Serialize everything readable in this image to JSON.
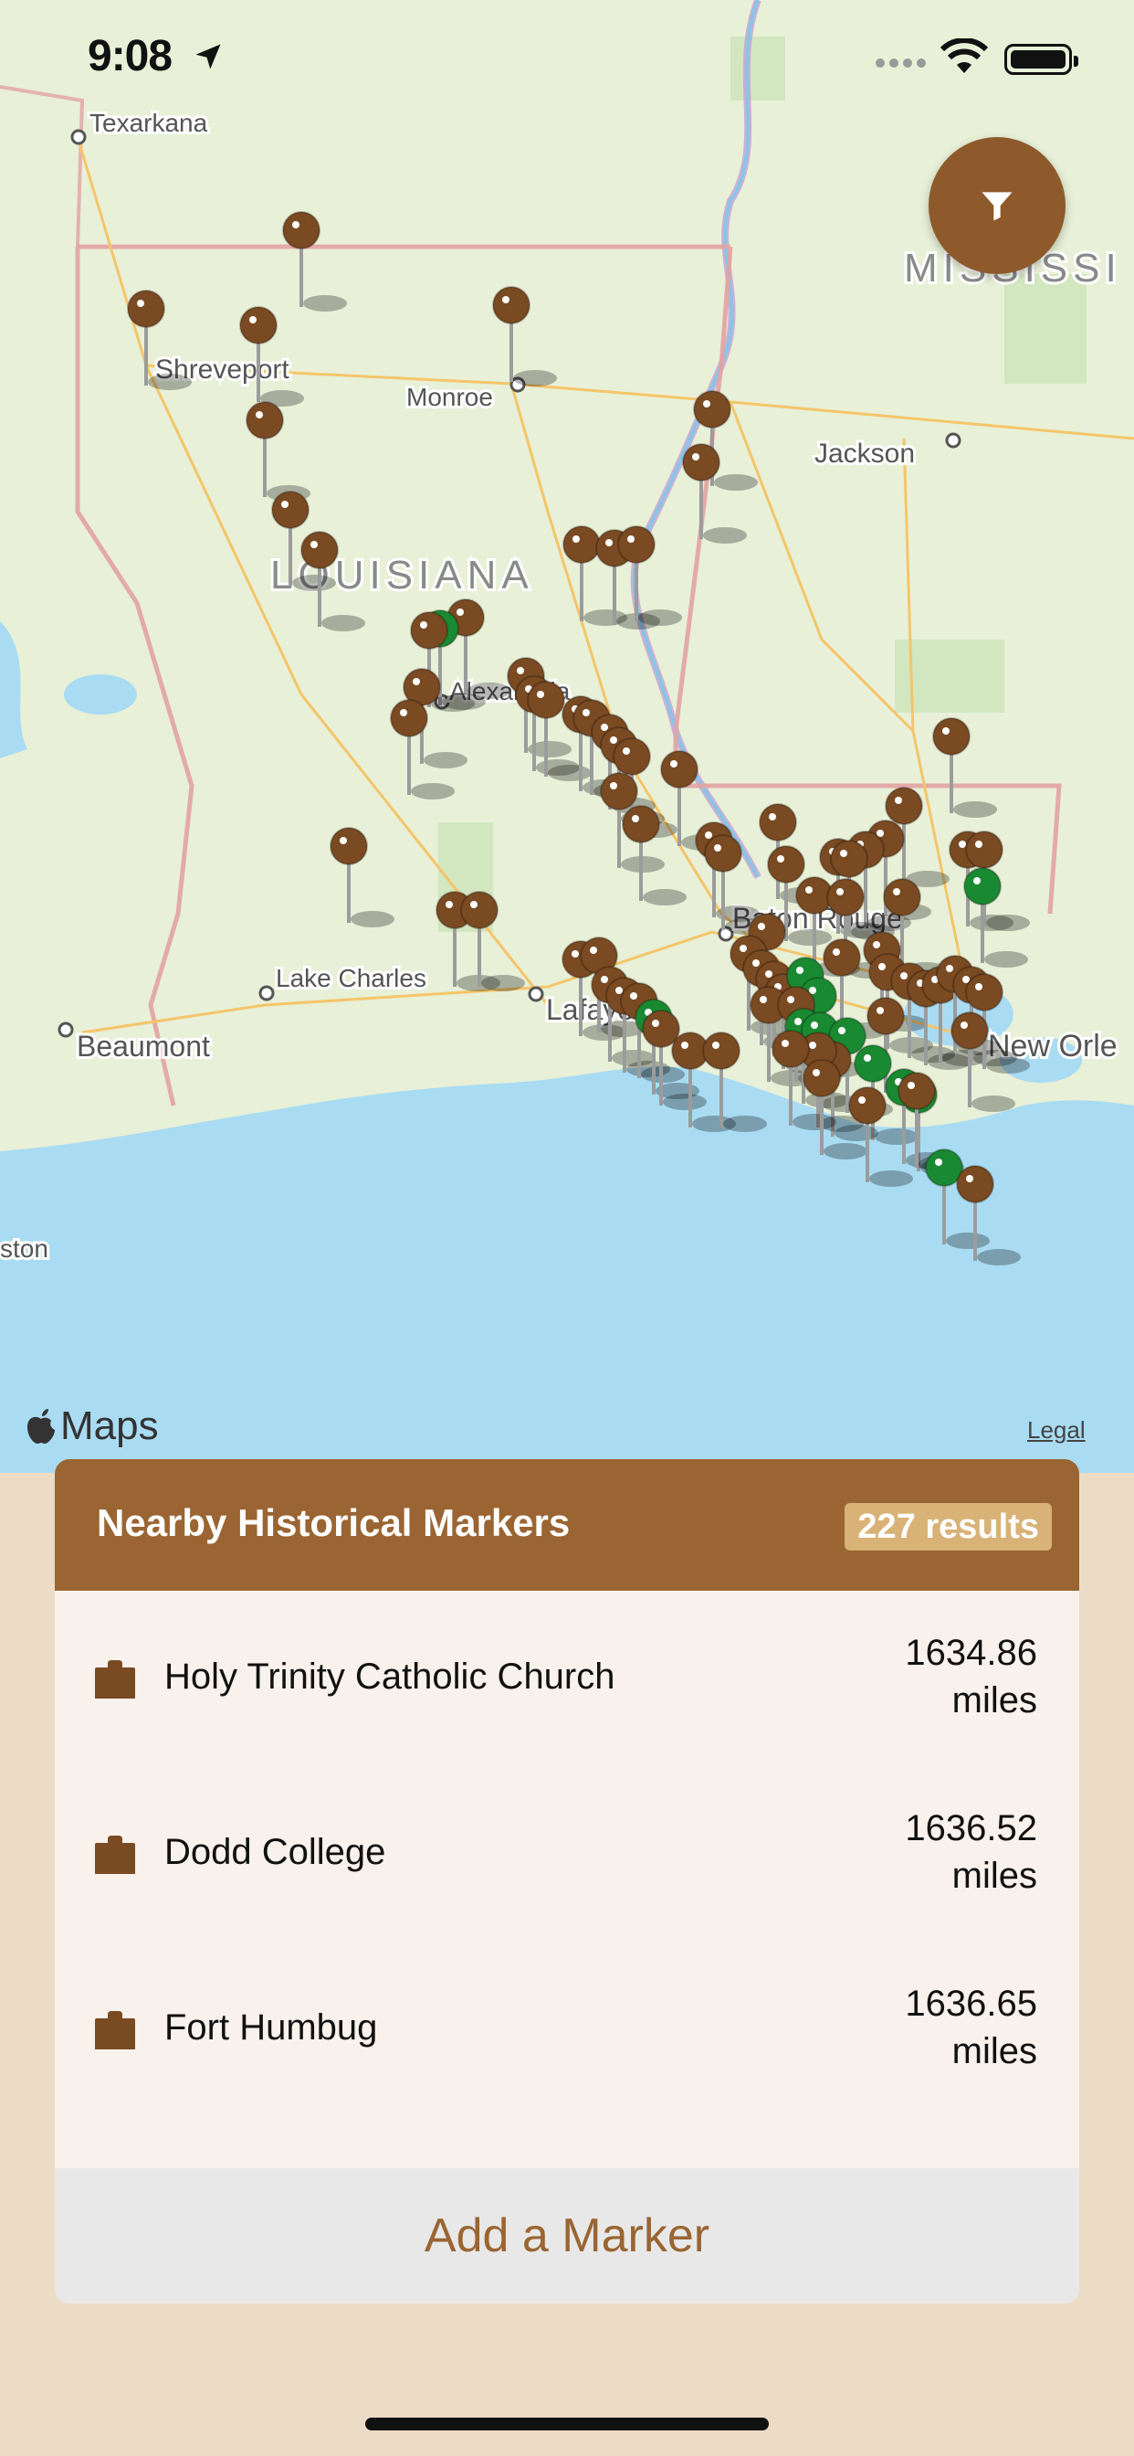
{
  "status_bar": {
    "time": "9:08"
  },
  "map": {
    "labels": {
      "texarkana": "Texarkana",
      "shreveport": "Shreveport",
      "monroe": "Monroe",
      "jackson": "Jackson",
      "louisiana": "LOUISIANA",
      "mississippi": "MISSISSI",
      "alexandria": "Alexandria",
      "lake_charles": "Lake Charles",
      "beaumont": "Beaumont",
      "lafayette": "Lafayette",
      "baton_rouge": "Baton Rouge",
      "new_orleans": "New Orle",
      "houston": "ston"
    },
    "credit": "Maps",
    "legal": "Legal",
    "colors": {
      "pin_brown": "#7a4a22",
      "pin_green": "#1a8a32",
      "land": "#e8f0d8",
      "water": "#a9dcf2"
    }
  },
  "filter_button": {
    "icon": "filter-icon"
  },
  "panel": {
    "title": "Nearby Historical Markers",
    "results": "227 results",
    "items": [
      {
        "name": "Holy Trinity Catholic Church",
        "distance": "1634.86",
        "unit": "miles"
      },
      {
        "name": "Dodd College",
        "distance": "1636.52",
        "unit": "miles"
      },
      {
        "name": "Fort Humbug",
        "distance": "1636.65",
        "unit": "miles"
      }
    ],
    "add_button": "Add a Marker"
  }
}
